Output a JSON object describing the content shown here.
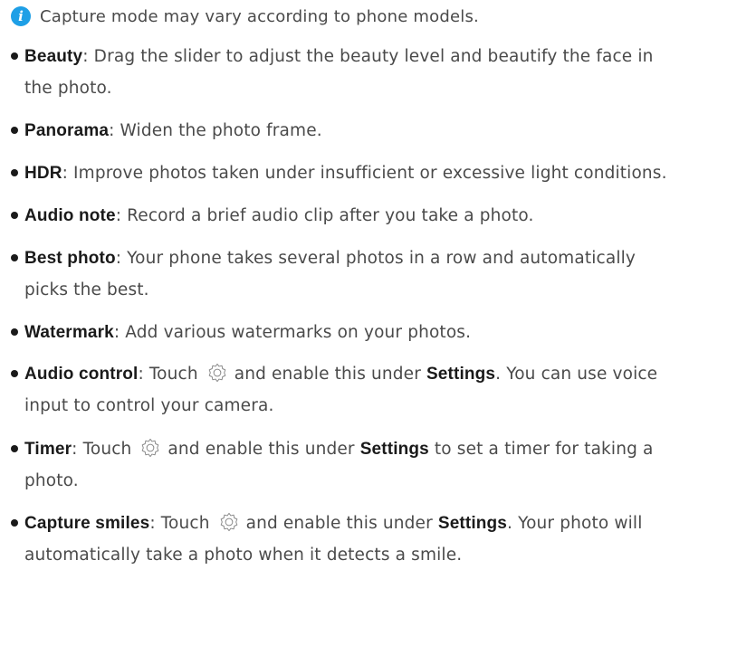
{
  "note": {
    "icon": "info-icon",
    "icon_glyph": "i",
    "text": "Capture mode may vary according to phone models."
  },
  "items": [
    {
      "term": "Beauty",
      "line1": ": Drag the slider to adjust the beauty level and beautify the face in",
      "line2": "the photo."
    },
    {
      "term": "Panorama",
      "line1": ": Widen the photo frame."
    },
    {
      "term": "HDR",
      "line1": ": Improve photos taken under insufficient or excessive light conditions."
    },
    {
      "term": "Audio note",
      "line1": ": Record a brief audio clip after you take a photo."
    },
    {
      "term": "Best photo",
      "line1": ": Your phone takes several photos in a row and automatically",
      "line2": "picks the best."
    },
    {
      "term": "Watermark",
      "line1": ": Add various watermarks on your photos."
    },
    {
      "term": "Audio control",
      "pre": ": Touch",
      "mid": "and enable this under",
      "kw": "Settings",
      "post": ". You can use voice",
      "line2": "input to control your camera."
    },
    {
      "term": "Timer",
      "pre": ": Touch",
      "mid": "and enable this under",
      "kw": "Settings",
      "post": " to set a timer for taking a",
      "line2": "photo."
    },
    {
      "term": "Capture smiles",
      "pre": ": Touch",
      "mid": "and enable this under",
      "kw": "Settings",
      "post": ". Your photo will",
      "line2": "automatically take a photo when it detects a smile."
    }
  ],
  "colors": {
    "info_icon": "#1e9fe6",
    "body_text": "#4a4a4a",
    "bold_text": "#1a1a1a"
  }
}
